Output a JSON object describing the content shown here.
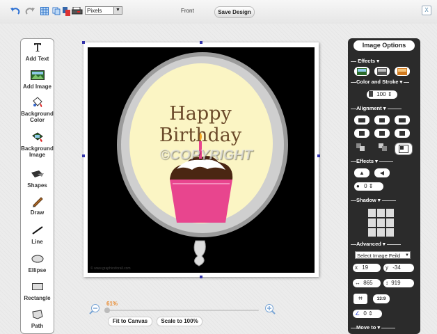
{
  "toolbar": {
    "icons": [
      "undo-icon",
      "redo-icon",
      "grid-icon",
      "copy-icon",
      "layers-icon",
      "printer-icon"
    ],
    "unit_select": "Pixels",
    "view_label": "Front",
    "save_label": "Save Design",
    "close_label": "X"
  },
  "tools": [
    {
      "name": "add-text",
      "label": "Add Text",
      "icon": "text-icon"
    },
    {
      "name": "add-image",
      "label": "Add Image",
      "icon": "image-icon"
    },
    {
      "name": "background-color",
      "label": "Background Color",
      "icon": "paint-bucket-icon"
    },
    {
      "name": "background-image",
      "label": "Background Image",
      "icon": "background-image-icon"
    },
    {
      "name": "shapes",
      "label": "Shapes",
      "icon": "shapes-icon"
    },
    {
      "name": "draw",
      "label": "Draw",
      "icon": "pencil-icon"
    },
    {
      "name": "line",
      "label": "Line",
      "icon": "line-icon"
    },
    {
      "name": "ellipse",
      "label": "Ellipse",
      "icon": "ellipse-icon"
    },
    {
      "name": "rectangle",
      "label": "Rectangle",
      "icon": "rectangle-icon"
    },
    {
      "name": "path",
      "label": "Path",
      "icon": "path-icon"
    }
  ],
  "canvas": {
    "text_happy": "Happy Birthday",
    "watermark": "©COPYRIGHT",
    "footer_text": "© www.graphicsforall.com"
  },
  "zoom": {
    "percent": "61%",
    "fit_label": "Fit to Canvas",
    "scale_label": "Scale to 100%"
  },
  "panel": {
    "title": "Image Options",
    "effects_label": "Effects",
    "color_stroke_label": "Color and Stroke",
    "stroke_value": "100",
    "alignment_label": "Alignment",
    "effects2_label": "Effects",
    "effect_value": "0",
    "shadow_label": "Shadow",
    "advanced_label": "Advanced",
    "select_field": "Select Image Feild",
    "x_label": "x",
    "x_value": "19",
    "y_label": "y",
    "y_value": "-34",
    "width_value": "865",
    "height_value": "919",
    "ratio_label": "13:9",
    "rotate_value": "0",
    "move_to_label": "Move to"
  },
  "colors": {
    "accent_orange": "#e98a2e",
    "panel_bg": "#2b2b2b",
    "cupcake_pink": "#e8458e",
    "balloon_cream": "#fbf5c4"
  }
}
